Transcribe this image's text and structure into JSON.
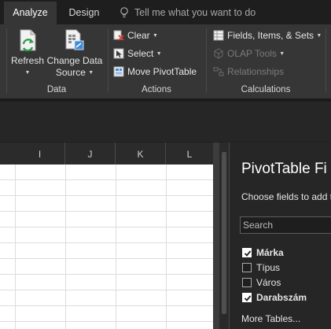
{
  "tabs": {
    "analyze": "Analyze",
    "design": "Design",
    "tell_me": "Tell me what you want to do"
  },
  "ribbon": {
    "data_group": {
      "label": "Data",
      "refresh": "Refresh",
      "change_source_line1": "Change Data",
      "change_source_line2": "Source"
    },
    "actions_group": {
      "label": "Actions",
      "clear": "Clear",
      "select": "Select",
      "move": "Move PivotTable"
    },
    "calculations_group": {
      "label": "Calculations",
      "fields_items_sets": "Fields, Items, & Sets",
      "olap_tools": "OLAP Tools",
      "relationships": "Relationships"
    }
  },
  "sheet": {
    "columns": [
      "I",
      "J",
      "K",
      "L"
    ]
  },
  "pivot_pane": {
    "title": "PivotTable Fi",
    "subtitle": "Choose fields to add t",
    "search_placeholder": "Search",
    "fields": [
      {
        "label": "Márka",
        "checked": true
      },
      {
        "label": "Típus",
        "checked": false
      },
      {
        "label": "Város",
        "checked": false
      },
      {
        "label": "Darabszám",
        "checked": true
      }
    ],
    "more_tables": "More Tables..."
  },
  "colors": {
    "ribbon_bg": "#363636",
    "tab_bar_bg": "#1e1e1e",
    "pane_bg": "#262626",
    "refresh_green": "#2e9e4a",
    "accent_blue": "#3f8ad6"
  }
}
